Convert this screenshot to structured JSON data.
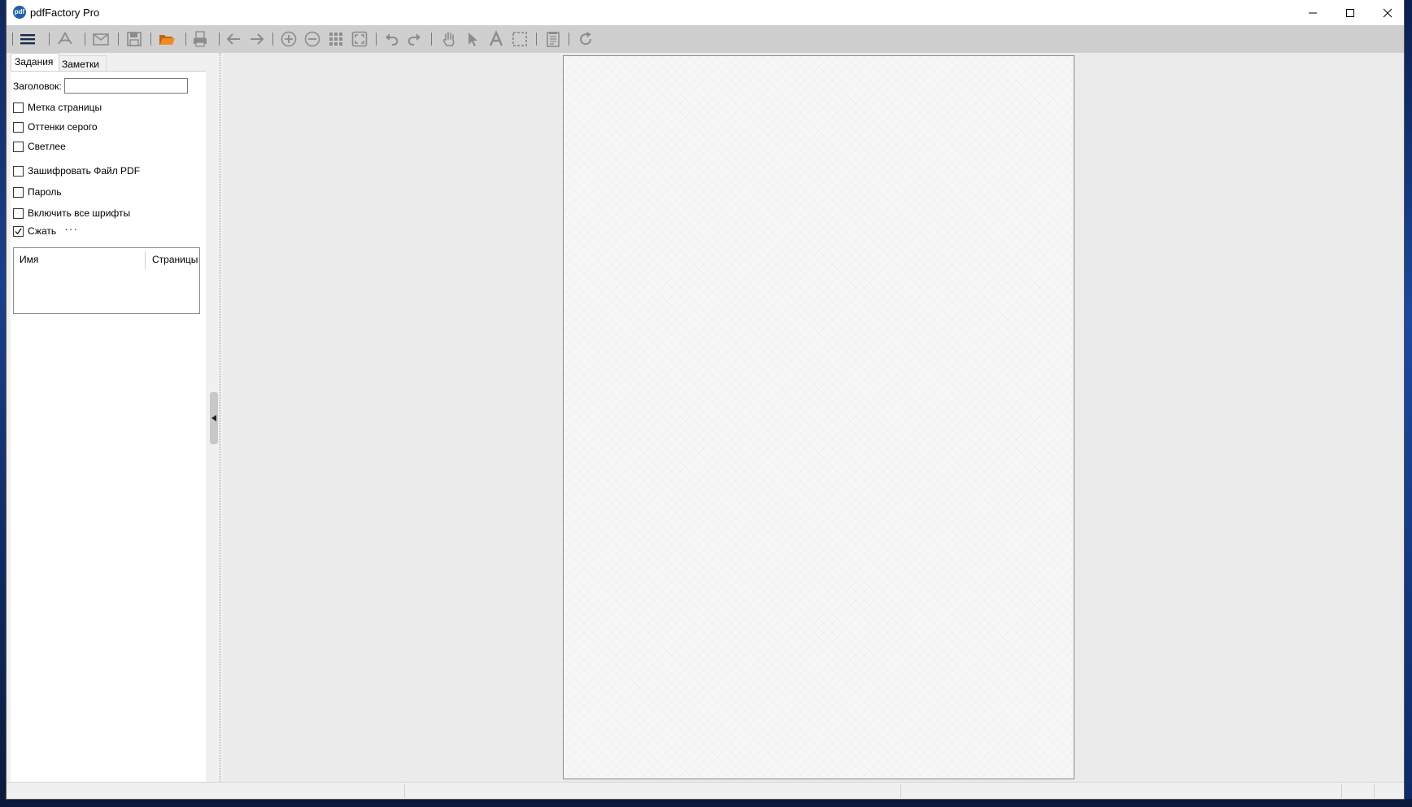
{
  "window": {
    "title": "pdfFactory Pro",
    "app_icon_text": "pdf"
  },
  "toolbar": {
    "buttons": [
      {
        "name": "menu-icon",
        "enabled": true
      },
      {
        "name": "acrobat-icon",
        "enabled": false
      },
      {
        "name": "email-icon",
        "enabled": false
      },
      {
        "name": "save-icon",
        "enabled": false
      },
      {
        "name": "open-folder-icon",
        "enabled": true
      },
      {
        "name": "print-icon",
        "enabled": false
      },
      {
        "name": "arrow-left-icon",
        "enabled": false
      },
      {
        "name": "arrow-right-icon",
        "enabled": false
      },
      {
        "name": "zoom-in-icon",
        "enabled": false
      },
      {
        "name": "zoom-out-icon",
        "enabled": false
      },
      {
        "name": "grid-icon",
        "enabled": false
      },
      {
        "name": "fit-page-icon",
        "enabled": false
      },
      {
        "name": "undo-icon",
        "enabled": false
      },
      {
        "name": "redo-icon",
        "enabled": false
      },
      {
        "name": "hand-icon",
        "enabled": false
      },
      {
        "name": "pointer-icon",
        "enabled": false
      },
      {
        "name": "text-tool-icon",
        "enabled": false
      },
      {
        "name": "select-rect-icon",
        "enabled": false
      },
      {
        "name": "notes-icon",
        "enabled": false
      },
      {
        "name": "refresh-icon",
        "enabled": false
      }
    ],
    "colors": {
      "enabled": "#1e2a4a",
      "disabled": "#8c8c8c",
      "folder": "#e07b1a"
    }
  },
  "tabs": {
    "jobs": "Задания",
    "notes": "Заметки"
  },
  "panel": {
    "title_label": "Заголовок:",
    "title_value": "",
    "checkboxes": {
      "page_mark": {
        "label": "Метка страницы",
        "checked": false
      },
      "grayscale": {
        "label": "Оттенки серого",
        "checked": false
      },
      "lighter": {
        "label": "Светлее",
        "checked": false
      },
      "encrypt": {
        "label": "Зашифровать Файл PDF",
        "checked": false
      },
      "password": {
        "label": "Пароль",
        "checked": false
      },
      "embed_fonts": {
        "label": "Включить все шрифты",
        "checked": false
      },
      "compress": {
        "label": "Сжать",
        "checked": true
      }
    },
    "more_label": "···",
    "list": {
      "col_name": "Имя",
      "col_pages": "Страницы"
    }
  }
}
